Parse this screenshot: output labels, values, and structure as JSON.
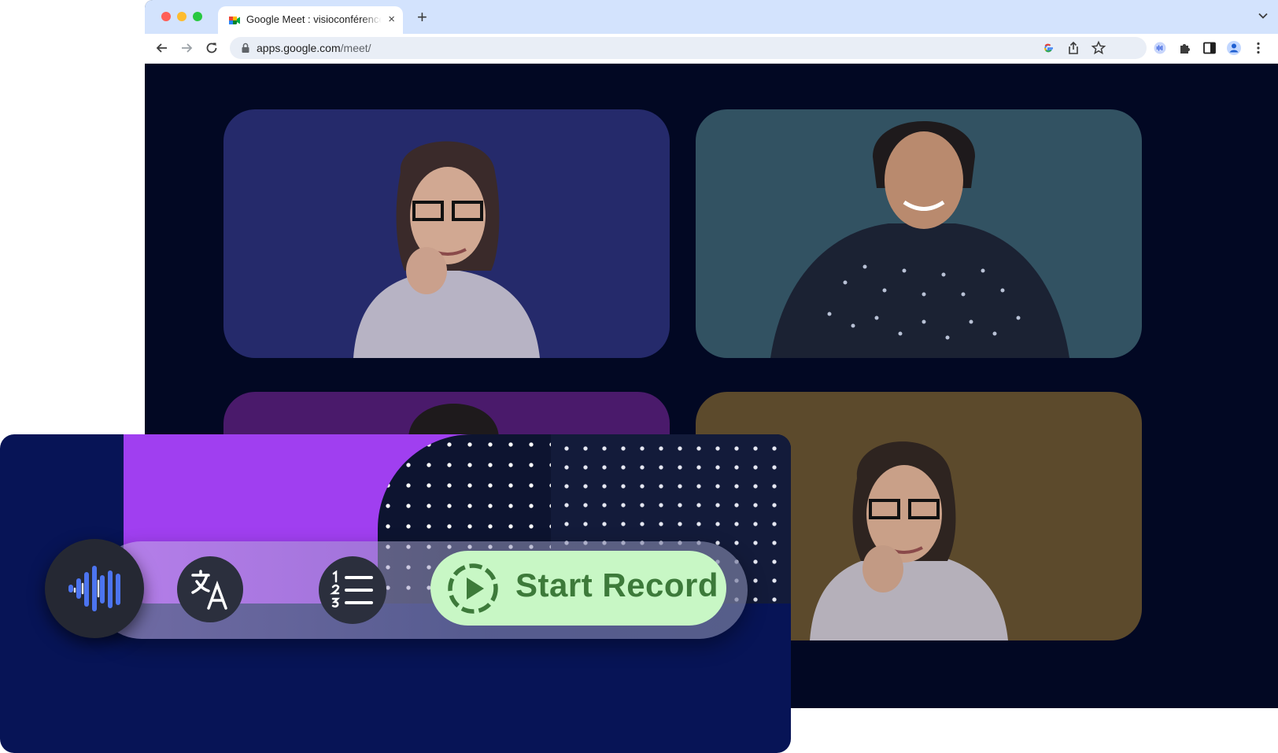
{
  "browser": {
    "tab_title": "Google Meet : visioconférence",
    "tab_close": "×",
    "new_tab": "+",
    "url_host": "apps.google.com",
    "url_path": "/meet/"
  },
  "meet": {
    "tiles": [
      {
        "id": "participant-1",
        "background": "#252a6b"
      },
      {
        "id": "participant-2",
        "background": "#325262"
      },
      {
        "id": "participant-3",
        "background": "#4a1a6b"
      },
      {
        "id": "participant-4",
        "background": "#5c4a2c"
      }
    ]
  },
  "toolbar_overlay": {
    "record_label": "Start Record",
    "colors": {
      "record_bg": "#c8f7c5",
      "record_text": "#3d7a3a",
      "wave_accent": "#4c74f0",
      "overlay_bg": "#071456"
    },
    "icons": [
      "audio-wave-icon",
      "translate-icon",
      "numbered-list-icon",
      "record-play-icon"
    ]
  }
}
